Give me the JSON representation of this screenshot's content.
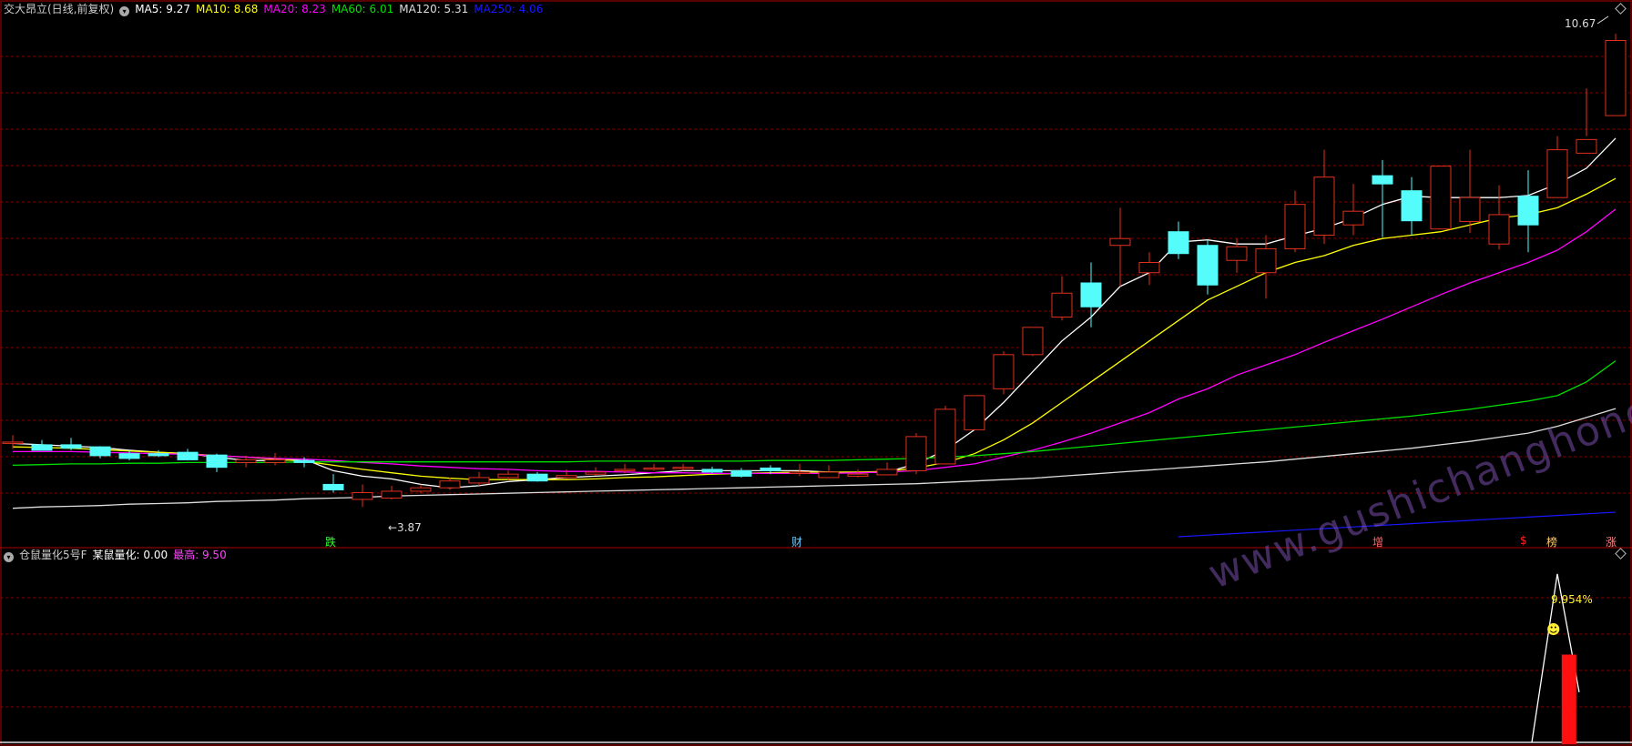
{
  "header": {
    "title": "交大昂立(日线,前复权)",
    "ma": [
      {
        "label": "MA5: 9.27",
        "color": "#ffffff"
      },
      {
        "label": "MA10: 8.68",
        "color": "#ffff00"
      },
      {
        "label": "MA20: 8.23",
        "color": "#ff00ff"
      },
      {
        "label": "MA60: 6.01",
        "color": "#00e000"
      },
      {
        "label": "MA120: 5.31",
        "color": "#dddddd"
      },
      {
        "label": "MA250: 4.06",
        "color": "#1818ff"
      }
    ]
  },
  "sub_header": {
    "title": "仓鼠量化5号F",
    "value_label": "某鼠量化: 0.00",
    "max_label": "最高: 9.50"
  },
  "annotations": {
    "price_high": "10.67",
    "price_low": "←3.87",
    "mark_die": "跌",
    "mark_cai": "财",
    "mark_zeng": "增",
    "mark_s": "$",
    "mark_bang": "榜",
    "mark_zhang": "涨",
    "pct": "9.954%",
    "watermark": "www.gushichanghong.com"
  },
  "colors": {
    "up": "#e0301e",
    "down": "#54fcfc",
    "grid": "#7a0000",
    "frame": "#b00000",
    "ma5": "#ffffff",
    "ma10": "#ffff00",
    "ma20": "#ff00ff",
    "ma60": "#00e000",
    "ma120": "#dddddd",
    "ma250": "#1818ff"
  },
  "chart_data": [
    {
      "type": "candlestick",
      "title": "交大昂立(日线,前复权)",
      "ylim": [
        3.3,
        11.0
      ],
      "x": [
        0,
        1,
        2,
        3,
        4,
        5,
        6,
        7,
        8,
        9,
        10,
        11,
        12,
        13,
        14,
        15,
        16,
        17,
        18,
        19,
        20,
        21,
        22,
        23,
        24,
        25,
        26,
        27,
        28,
        29,
        30,
        31,
        32,
        33,
        34,
        35,
        36,
        37,
        38,
        39,
        40,
        41,
        42,
        43,
        44,
        45,
        46,
        47,
        48,
        49,
        50,
        51,
        52,
        53,
        54,
        55
      ],
      "open": [
        4.8,
        4.78,
        4.78,
        4.75,
        4.65,
        4.65,
        4.67,
        4.63,
        4.52,
        4.52,
        4.55,
        4.2,
        3.98,
        4.0,
        4.1,
        4.15,
        4.22,
        4.3,
        4.35,
        4.3,
        4.35,
        4.42,
        4.44,
        4.44,
        4.42,
        4.4,
        4.44,
        4.38,
        4.3,
        4.32,
        4.34,
        4.4,
        4.5,
        5.0,
        5.6,
        6.1,
        6.65,
        7.15,
        7.7,
        7.3,
        7.9,
        7.7,
        7.48,
        7.3,
        7.65,
        7.85,
        8.0,
        8.72,
        8.5,
        7.94,
        8.05,
        7.72,
        8.42,
        8.4,
        9.05,
        9.6
      ],
      "close": [
        4.82,
        4.7,
        4.73,
        4.62,
        4.58,
        4.62,
        4.56,
        4.45,
        4.56,
        4.56,
        4.52,
        4.12,
        4.08,
        4.1,
        4.15,
        4.25,
        4.3,
        4.35,
        4.25,
        4.33,
        4.38,
        4.42,
        4.44,
        4.45,
        4.38,
        4.32,
        4.4,
        4.38,
        4.38,
        4.35,
        4.42,
        4.9,
        5.3,
        5.5,
        6.1,
        6.5,
        7.0,
        6.8,
        7.8,
        7.45,
        7.58,
        7.12,
        7.68,
        7.65,
        8.3,
        8.7,
        8.2,
        8.6,
        8.06,
        8.86,
        8.4,
        8.15,
        8.0,
        9.1,
        9.25,
        10.7
      ],
      "high": [
        4.92,
        4.85,
        4.88,
        4.76,
        4.7,
        4.7,
        4.72,
        4.65,
        4.62,
        4.66,
        4.6,
        4.35,
        4.2,
        4.18,
        4.2,
        4.3,
        4.38,
        4.4,
        4.38,
        4.42,
        4.45,
        4.5,
        4.5,
        4.5,
        4.46,
        4.44,
        4.48,
        4.5,
        4.48,
        4.42,
        4.52,
        4.95,
        5.35,
        5.5,
        6.15,
        6.5,
        7.25,
        7.45,
        8.25,
        7.6,
        8.05,
        7.78,
        7.8,
        7.85,
        8.5,
        9.1,
        8.6,
        8.95,
        8.7,
        8.86,
        9.1,
        8.58,
        8.8,
        9.3,
        10.0,
        10.8
      ],
      "low": [
        4.72,
        4.7,
        4.7,
        4.58,
        4.55,
        4.6,
        4.55,
        4.38,
        4.45,
        4.48,
        4.45,
        4.08,
        3.87,
        3.98,
        4.07,
        4.12,
        4.18,
        4.26,
        4.24,
        4.28,
        4.33,
        4.36,
        4.4,
        4.4,
        4.36,
        4.3,
        4.35,
        4.32,
        4.3,
        4.3,
        4.35,
        4.35,
        4.5,
        5.0,
        5.52,
        6.08,
        6.6,
        6.5,
        7.1,
        7.12,
        7.5,
        6.98,
        7.3,
        6.92,
        7.6,
        7.72,
        7.85,
        7.82,
        7.85,
        8.4,
        7.88,
        7.64,
        7.6,
        9.02,
        9.3,
        10.65
      ]
    },
    {
      "type": "line",
      "series": [
        {
          "name": "MA5",
          "values": [
            4.8,
            4.78,
            4.76,
            4.74,
            4.7,
            4.67,
            4.65,
            4.6,
            4.55,
            4.55,
            4.57,
            4.4,
            4.32,
            4.28,
            4.2,
            4.15,
            4.18,
            4.24,
            4.27,
            4.3,
            4.32,
            4.34,
            4.37,
            4.4,
            4.4,
            4.4,
            4.4,
            4.4,
            4.38,
            4.37,
            4.38,
            4.5,
            4.7,
            5.0,
            5.4,
            5.85,
            6.3,
            6.65,
            7.1,
            7.3,
            7.75,
            7.78,
            7.72,
            7.72,
            7.84,
            7.95,
            8.1,
            8.3,
            8.42,
            8.4,
            8.4,
            8.4,
            8.43,
            8.6,
            8.83,
            9.27
          ]
        },
        {
          "name": "MA10",
          "values": [
            4.75,
            4.74,
            4.73,
            4.71,
            4.69,
            4.67,
            4.65,
            4.62,
            4.6,
            4.57,
            4.54,
            4.48,
            4.42,
            4.37,
            4.32,
            4.29,
            4.27,
            4.27,
            4.27,
            4.27,
            4.28,
            4.3,
            4.31,
            4.33,
            4.35,
            4.36,
            4.37,
            4.38,
            4.38,
            4.38,
            4.39,
            4.44,
            4.52,
            4.65,
            4.85,
            5.1,
            5.4,
            5.7,
            6.0,
            6.3,
            6.6,
            6.9,
            7.1,
            7.3,
            7.45,
            7.55,
            7.7,
            7.8,
            7.85,
            7.9,
            8.0,
            8.1,
            8.15,
            8.25,
            8.45,
            8.68
          ]
        },
        {
          "name": "MA20",
          "values": [
            4.68,
            4.68,
            4.68,
            4.67,
            4.66,
            4.65,
            4.64,
            4.62,
            4.6,
            4.58,
            4.57,
            4.55,
            4.52,
            4.5,
            4.47,
            4.45,
            4.43,
            4.42,
            4.4,
            4.39,
            4.39,
            4.38,
            4.37,
            4.37,
            4.36,
            4.36,
            4.36,
            4.36,
            4.36,
            4.37,
            4.38,
            4.4,
            4.45,
            4.5,
            4.6,
            4.7,
            4.82,
            4.95,
            5.1,
            5.25,
            5.45,
            5.6,
            5.8,
            5.95,
            6.1,
            6.28,
            6.45,
            6.62,
            6.8,
            6.98,
            7.15,
            7.3,
            7.45,
            7.63,
            7.9,
            8.23
          ]
        },
        {
          "name": "MA60",
          "values": [
            4.48,
            4.49,
            4.5,
            4.5,
            4.51,
            4.51,
            4.52,
            4.52,
            4.52,
            4.52,
            4.53,
            4.53,
            4.53,
            4.53,
            4.53,
            4.53,
            4.53,
            4.53,
            4.53,
            4.53,
            4.54,
            4.54,
            4.54,
            4.54,
            4.54,
            4.54,
            4.55,
            4.55,
            4.55,
            4.56,
            4.57,
            4.58,
            4.6,
            4.62,
            4.65,
            4.68,
            4.72,
            4.76,
            4.8,
            4.84,
            4.88,
            4.92,
            4.96,
            5.0,
            5.04,
            5.08,
            5.12,
            5.16,
            5.2,
            5.25,
            5.3,
            5.36,
            5.42,
            5.5,
            5.7,
            6.01
          ]
        },
        {
          "name": "MA120",
          "values": [
            3.85,
            3.87,
            3.88,
            3.89,
            3.91,
            3.92,
            3.93,
            3.95,
            3.96,
            3.97,
            3.99,
            4.0,
            4.01,
            4.03,
            4.04,
            4.05,
            4.06,
            4.07,
            4.08,
            4.09,
            4.1,
            4.11,
            4.12,
            4.13,
            4.14,
            4.15,
            4.16,
            4.17,
            4.18,
            4.19,
            4.2,
            4.21,
            4.23,
            4.25,
            4.27,
            4.29,
            4.32,
            4.35,
            4.38,
            4.41,
            4.44,
            4.47,
            4.5,
            4.53,
            4.57,
            4.61,
            4.65,
            4.69,
            4.73,
            4.78,
            4.83,
            4.89,
            4.95,
            5.05,
            5.18,
            5.31
          ]
        }
      ]
    },
    {
      "type": "line",
      "title": "仓鼠量化5号F",
      "ylim": [
        0,
        10
      ],
      "series": [
        {
          "name": "某鼠量化",
          "values": [
            0,
            0,
            0,
            0,
            0,
            0,
            0,
            0,
            0,
            0,
            0,
            0,
            0,
            0,
            0,
            0,
            0,
            0,
            0,
            0,
            0,
            0,
            0,
            0,
            0,
            0,
            0,
            0,
            0,
            0,
            0,
            0,
            0,
            0,
            0,
            0,
            0,
            0,
            0,
            0,
            0,
            0,
            0,
            0,
            0,
            0,
            0,
            0,
            0,
            0,
            0,
            0,
            0,
            9.5,
            0.0,
            0.0
          ]
        }
      ]
    },
    {
      "type": "bar",
      "series": [
        {
          "name": "signal",
          "values": [
            {
              "x": 53.4,
              "y": 5.0
            }
          ]
        }
      ]
    }
  ]
}
